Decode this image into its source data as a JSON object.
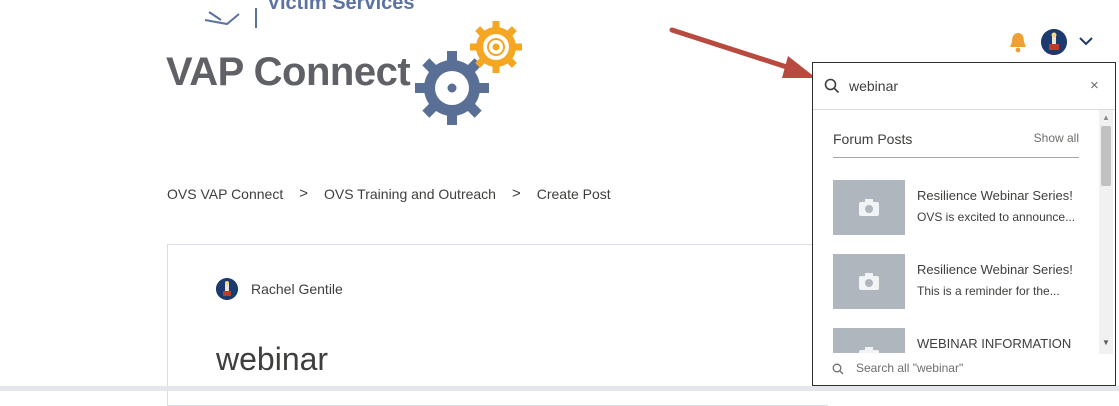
{
  "header": {
    "org_wordmark": "Victim Services",
    "app_title": "VAP Connect",
    "bell_icon": "bell-icon",
    "bell_color": "#f0a030",
    "avatar_icon": "user-avatar",
    "menu_icon": "chevron-down-icon"
  },
  "breadcrumb": {
    "items": [
      "OVS VAP Connect",
      "OVS Training and Outreach",
      "Create Post"
    ],
    "separator": ">"
  },
  "post": {
    "author": "Rachel Gentile",
    "title": "webinar"
  },
  "search": {
    "query": "webinar",
    "clear_label": "×",
    "section_label": "Forum Posts",
    "show_all_label": "Show all",
    "results": [
      {
        "title": "Resilience Webinar Series!",
        "snippet": "OVS is excited to announce..."
      },
      {
        "title": "Resilience Webinar Series!",
        "snippet": "This is a reminder for the..."
      },
      {
        "title": "WEBINAR INFORMATION",
        "snippet": ""
      }
    ],
    "search_all_label": "Search all \"webinar\""
  },
  "annotation": {
    "arrow_color": "#b94a3f"
  }
}
